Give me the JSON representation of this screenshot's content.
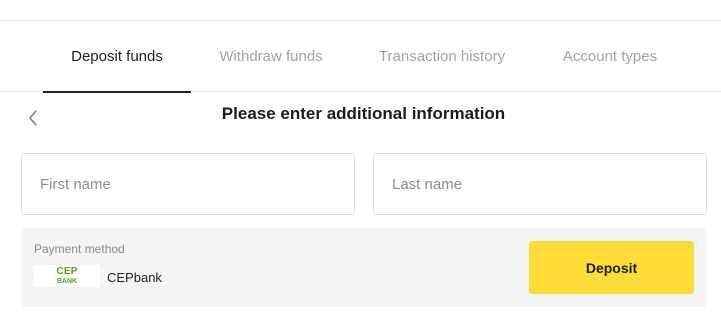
{
  "tabs": [
    {
      "label": "Deposit funds",
      "active": true
    },
    {
      "label": "Withdraw funds",
      "active": false
    },
    {
      "label": "Transaction history",
      "active": false
    },
    {
      "label": "Account types",
      "active": false
    }
  ],
  "header": {
    "back_icon": "chevron-left-icon",
    "title": "Please enter additional information"
  },
  "form": {
    "first_name": {
      "value": "",
      "placeholder": "First name"
    },
    "last_name": {
      "value": "",
      "placeholder": "Last name"
    }
  },
  "payment": {
    "label": "Payment method",
    "logo": {
      "line1": "CEP",
      "line2": "BANK"
    },
    "bank_name": "CEPbank",
    "deposit_label": "Deposit"
  },
  "colors": {
    "accent": "#fddc38",
    "logo_green": "#5aa021",
    "panel_bg": "#f4f4f4",
    "inactive_tab": "#a3a3a3"
  }
}
